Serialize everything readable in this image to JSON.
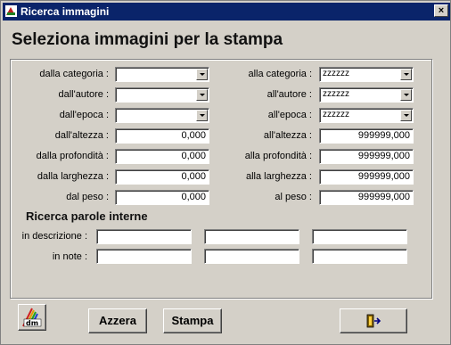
{
  "window": {
    "title": "Ricerca immagini",
    "close_label": "×"
  },
  "heading": "Seleziona immagini per la stampa",
  "filters": {
    "categoria": {
      "from_label": "dalla categoria :",
      "from_value": "",
      "to_label": "alla categoria :",
      "to_value": "zzzzzz"
    },
    "autore": {
      "from_label": "dall'autore :",
      "from_value": "",
      "to_label": "all'autore :",
      "to_value": "zzzzzz"
    },
    "epoca": {
      "from_label": "dall'epoca :",
      "from_value": "",
      "to_label": "all'epoca :",
      "to_value": "zzzzzz"
    },
    "altezza": {
      "from_label": "dall'altezza :",
      "from_value": "0,000",
      "to_label": "all'altezza :",
      "to_value": "999999,000"
    },
    "profondita": {
      "from_label": "dalla profondità :",
      "from_value": "0,000",
      "to_label": "alla profondità :",
      "to_value": "999999,000"
    },
    "larghezza": {
      "from_label": "dalla larghezza :",
      "from_value": "0,000",
      "to_label": "alla larghezza :",
      "to_value": "999999,000"
    },
    "peso": {
      "from_label": "dal peso :",
      "from_value": "0,000",
      "to_label": "al peso :",
      "to_value": "999999,000"
    }
  },
  "keywords": {
    "title": "Ricerca parole interne",
    "descrizione_label": "in descrizione :",
    "note_label": "in note :",
    "descrizione_values": [
      "",
      "",
      ""
    ],
    "note_values": [
      "",
      "",
      ""
    ]
  },
  "buttons": {
    "logo_icon": "dm-logo-icon",
    "azzera": "Azzera",
    "stampa": "Stampa",
    "exit_icon": "exit-door-icon"
  }
}
